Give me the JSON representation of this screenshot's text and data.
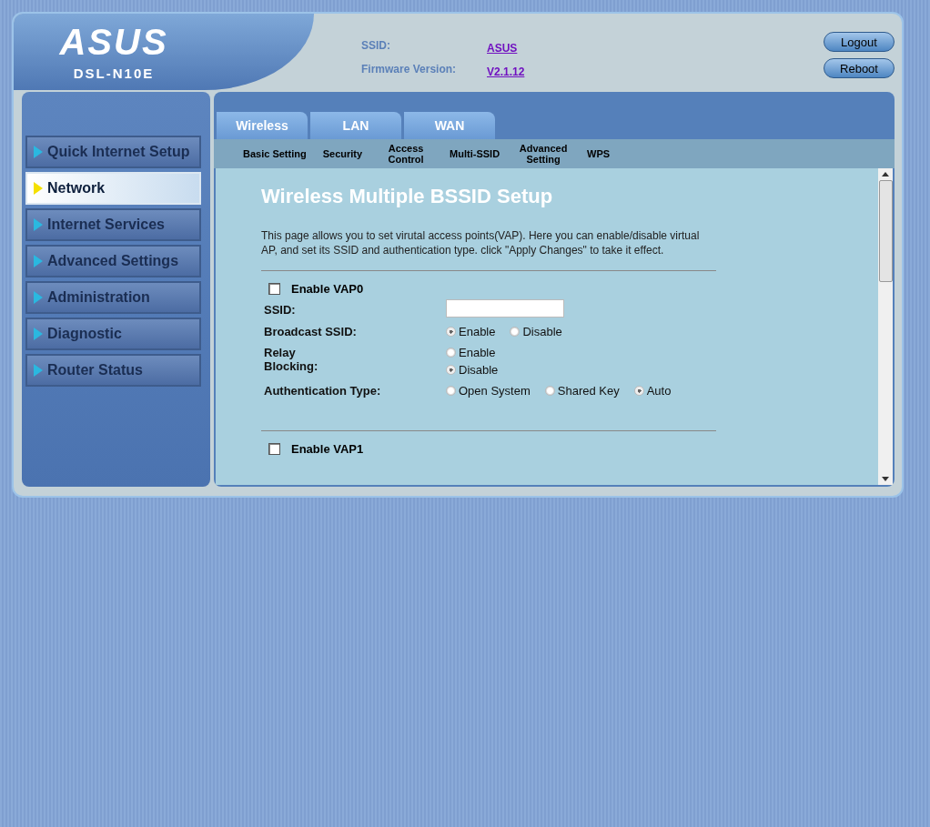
{
  "header": {
    "logo": "ASUS",
    "model": "DSL-N10E",
    "info": [
      {
        "label": "SSID:",
        "value": "ASUS"
      },
      {
        "label": "Firmware Version:",
        "value": "V2.1.12"
      }
    ],
    "buttons": [
      "Logout",
      "Reboot"
    ]
  },
  "sidebar": {
    "items": [
      {
        "label": "Quick Internet Setup",
        "selected": false
      },
      {
        "label": "Network",
        "selected": true
      },
      {
        "label": "Internet Services",
        "selected": false
      },
      {
        "label": "Advanced Settings",
        "selected": false
      },
      {
        "label": "Administration",
        "selected": false
      },
      {
        "label": "Diagnostic",
        "selected": false
      },
      {
        "label": "Router Status",
        "selected": false
      }
    ]
  },
  "tabs": [
    "Wireless",
    "LAN",
    "WAN"
  ],
  "subtabs": [
    "Basic Setting",
    "Security",
    "Access Control",
    "Multi-SSID",
    "Advanced Setting",
    "WPS"
  ],
  "page": {
    "title": "Wireless Multiple BSSID Setup",
    "description": "This page allows you to set virutal access points(VAP). Here you can enable/disable virtual AP, and set its SSID and authentication type. click \"Apply Changes\" to take it effect.",
    "vaps": [
      {
        "label": "Enable VAP0",
        "checked": false,
        "fields": [
          {
            "kind": "text",
            "label": "SSID:"
          },
          {
            "kind": "radio",
            "label": "Broadcast SSID:",
            "options": [
              {
                "label": "Enable",
                "selected": true
              },
              {
                "label": "Disable",
                "selected": false
              }
            ]
          },
          {
            "kind": "radio-stacked",
            "label": "Relay Blocking:",
            "options": [
              {
                "label": "Enable",
                "selected": false
              },
              {
                "label": "Disable",
                "selected": true
              }
            ]
          },
          {
            "kind": "radio",
            "label": "Authentication Type:",
            "options": [
              {
                "label": "Open System",
                "selected": false
              },
              {
                "label": "Shared Key",
                "selected": false
              },
              {
                "label": "Auto",
                "selected": true
              }
            ]
          }
        ]
      },
      {
        "label": "Enable VAP1",
        "checked": false
      }
    ]
  }
}
